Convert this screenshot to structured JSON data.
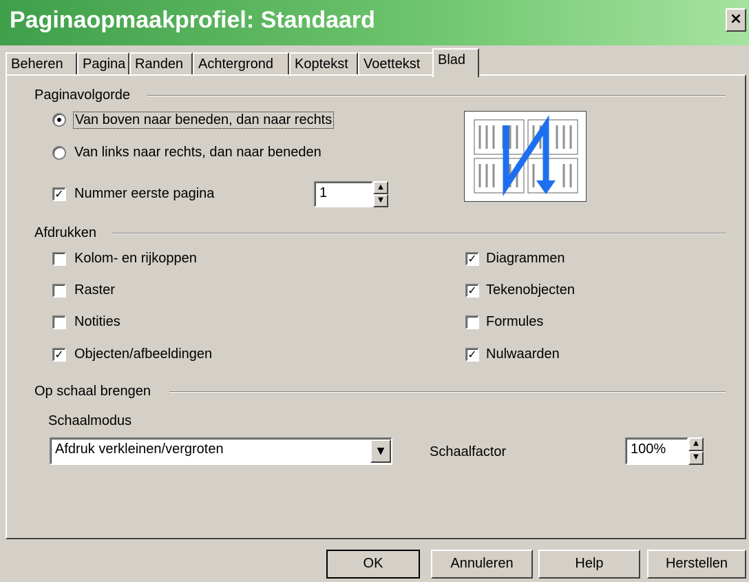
{
  "window": {
    "title": "Paginaopmaakprofiel: Standaard",
    "close_glyph": "×"
  },
  "tabs": [
    {
      "label": "Beheren"
    },
    {
      "label": "Pagina"
    },
    {
      "label": "Randen"
    },
    {
      "label": "Achtergrond"
    },
    {
      "label": "Koptekst"
    },
    {
      "label": "Voettekst"
    },
    {
      "label": "Blad",
      "active": true
    }
  ],
  "page_order": {
    "section_label": "Paginavolgorde",
    "option_top_down": "Van boven naar beneden, dan naar rechts",
    "option_left_right": "Van links naar rechts, dan naar beneden",
    "selected": "top_down",
    "first_page_label": "Nummer eerste pagina",
    "first_page_checked": true,
    "first_page_value": "1"
  },
  "print": {
    "section_label": "Afdrukken",
    "left": [
      {
        "label": "Kolom- en rijkoppen",
        "checked": false
      },
      {
        "label": "Raster",
        "checked": false
      },
      {
        "label": "Notities",
        "checked": false
      },
      {
        "label": "Objecten/afbeeldingen",
        "checked": true
      }
    ],
    "right": [
      {
        "label": "Diagrammen",
        "checked": true
      },
      {
        "label": "Tekenobjecten",
        "checked": true
      },
      {
        "label": "Formules",
        "checked": false
      },
      {
        "label": "Nulwaarden",
        "checked": true
      }
    ]
  },
  "scale": {
    "section_label": "Op schaal brengen",
    "mode_label": "Schaalmodus",
    "mode_value": "Afdruk verkleinen/vergroten",
    "factor_label": "Schaalfactor",
    "factor_value": "100%"
  },
  "buttons": {
    "ok": "OK",
    "cancel": "Annuleren",
    "help": "Help",
    "reset": "Herstellen"
  },
  "colors": {
    "title_bar": "#3f9f4a",
    "dialog": "#d4d0c8",
    "arrow": "#1e6ff0"
  }
}
